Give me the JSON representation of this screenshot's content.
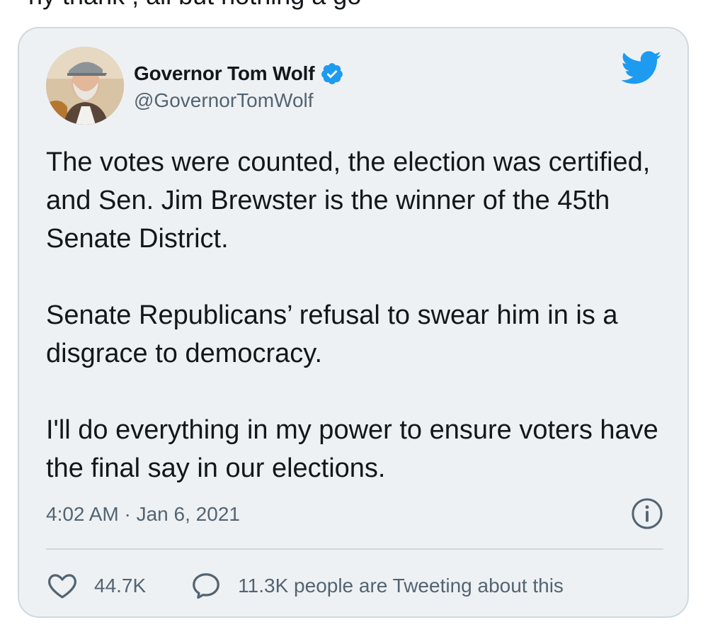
{
  "cropped_top_text": "ny thank , all but nothing a go",
  "tweet": {
    "author": {
      "display_name": "Governor Tom Wolf",
      "handle": "@GovernorTomWolf",
      "verified": true
    },
    "paragraphs": [
      "The votes were counted, the election was certified, and Sen. Jim Brewster is the winner of the 45th Senate District.",
      "Senate Republicans’ refusal to swear him in is a disgrace to democracy.",
      "I'll do everything in my power to ensure voters have the final say in our elections."
    ],
    "timestamp": "4:02 AM · Jan 6, 2021",
    "likes": "44.7K",
    "tweeting_about": "11.3K people are Tweeting about this"
  },
  "icons": {
    "brand": "twitter-bird-icon",
    "verified": "verified-badge-icon",
    "info": "info-icon",
    "like": "heart-icon",
    "reply": "speech-bubble-icon"
  },
  "colors": {
    "card_background": "#eef1f4",
    "border": "#cfd9de",
    "twitter_blue": "#1d9bf0",
    "secondary_text": "#536471",
    "primary_text": "#14171a"
  }
}
